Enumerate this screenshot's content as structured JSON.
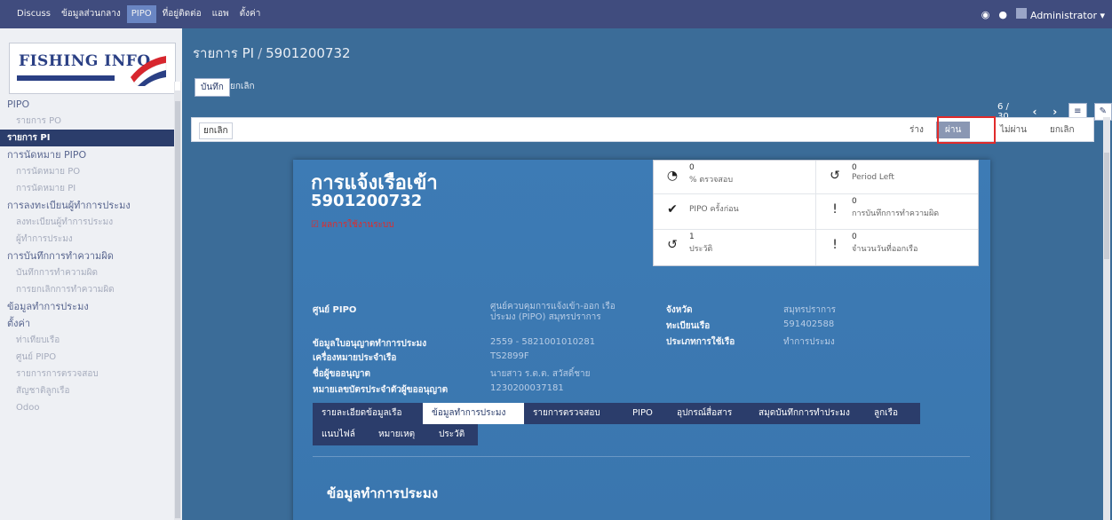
{
  "topbar": {
    "menu": [
      "Discuss",
      "ข้อมูลส่วนกลาง",
      "PIPO",
      "ที่อยู่ติดต่อ",
      "แอพ",
      "ตั้งค่า"
    ],
    "active_menu": "PIPO",
    "user": "Administrator ▾"
  },
  "sidebar": {
    "logo_text": "FISHING INFO",
    "items": [
      {
        "label": "PIPO",
        "kind": "h"
      },
      {
        "label": "รายการ PO",
        "kind": "sub"
      },
      {
        "label": "รายการ PI",
        "kind": "sel"
      },
      {
        "label": "การนัดหมาย PIPO",
        "kind": "h"
      },
      {
        "label": "การนัดหมาย PO",
        "kind": "sub"
      },
      {
        "label": "การนัดหมาย PI",
        "kind": "sub"
      },
      {
        "label": "การลงทะเบียนผู้ทำการประมง",
        "kind": "h"
      },
      {
        "label": "ลงทะเบียนผู้ทำการประมง",
        "kind": "sub"
      },
      {
        "label": "ผู้ทำการประมง",
        "kind": "sub"
      },
      {
        "label": "การบันทึกการทำความผิด",
        "kind": "h"
      },
      {
        "label": "บันทึกการทำความผิด",
        "kind": "sub"
      },
      {
        "label": "การยกเลิกการทำความผิด",
        "kind": "sub"
      },
      {
        "label": "ข้อมูลทำการประมง",
        "kind": "h"
      },
      {
        "label": "ตั้งค่า",
        "kind": "h"
      },
      {
        "label": "ท่าเทียบเรือ",
        "kind": "sub"
      },
      {
        "label": "ศูนย์ PIPO",
        "kind": "sub"
      },
      {
        "label": "รายการการตรวจสอบ",
        "kind": "sub"
      },
      {
        "label": "สัญชาติลูกเรือ",
        "kind": "sub"
      },
      {
        "label": "Odoo",
        "kind": "sub"
      }
    ]
  },
  "breadcrumb": {
    "parent": "รายการ PI",
    "current": "5901200732"
  },
  "actions": {
    "save": "บันทึก",
    "discard": "ยกเลิก"
  },
  "pager": {
    "text": "6 / 30",
    "prev": "‹",
    "next": "›",
    "list_view_icon": "≡",
    "form_view_icon": "✎"
  },
  "statusbar": {
    "cancel_button": "ยกเลิก",
    "stages": [
      "ร่าง",
      "ผ่าน",
      "ไม่ผ่าน",
      "ยกเลิก"
    ],
    "current_stage": "ผ่าน"
  },
  "record": {
    "title": "การแจ้งเรือเข้า",
    "number": "5901200732",
    "checkbox_label": "ผลการใช้งานระบบ",
    "stats": [
      {
        "value": "0",
        "label": "% ตรวจสอบ",
        "icon": "pie-chart-icon"
      },
      {
        "value": "0",
        "label": "Period Left",
        "icon": "history-icon"
      },
      {
        "value": "",
        "label": "PIPO ครั้งก่อน",
        "icon": "check-icon"
      },
      {
        "value": "0",
        "label": "การบันทึกการทำความผิด",
        "icon": "exclamation-icon"
      },
      {
        "value": "1",
        "label": "ประวัติ",
        "icon": "history-icon"
      },
      {
        "value": "0",
        "label": "จำนวนวันที่ออกเรือ",
        "icon": "exclamation-icon"
      }
    ],
    "fields_left": [
      {
        "label": "ศูนย์ PIPO",
        "value": "ศูนย์ควบคุมการแจ้งเข้า-ออก เรือประมง (PIPO) สมุทรปราการ"
      },
      {
        "label": "ข้อมูลใบอนุญาตทำการประมง",
        "value": "2559 - 5821001010281"
      },
      {
        "label": "เครื่องหมายประจำเรือ",
        "value": "TS2899F"
      },
      {
        "label": "ชื่อผู้ขออนุญาต",
        "value": "นายสาว ร.ต.ต. สวัสดิ์ชาย"
      },
      {
        "label": "หมายเลขบัตรประจำตัวผู้ขออนุญาต",
        "value": "1230200037181"
      }
    ],
    "fields_right": [
      {
        "label": "จังหวัด",
        "value": "สมุทรปราการ"
      },
      {
        "label": "ทะเบียนเรือ",
        "value": "591402588"
      },
      {
        "label": "ประเภทการใช้เรือ",
        "value": "ทำการประมง"
      }
    ],
    "tabs_row1": [
      "รายละเอียดข้อมูลเรือ",
      "ข้อมูลทำการประมง",
      "รายการตรวจสอบ",
      "PIPO",
      "อุปกรณ์สื่อสาร",
      "สมุดบันทึกการทำประมง",
      "ลูกเรือ"
    ],
    "tabs_row2": [
      "แนบไฟล์",
      "หมายเหตุ",
      "ประวัติ"
    ],
    "active_tab": "ข้อมูลทำการประมง",
    "section_title": "ข้อมูลทำการประมง"
  }
}
